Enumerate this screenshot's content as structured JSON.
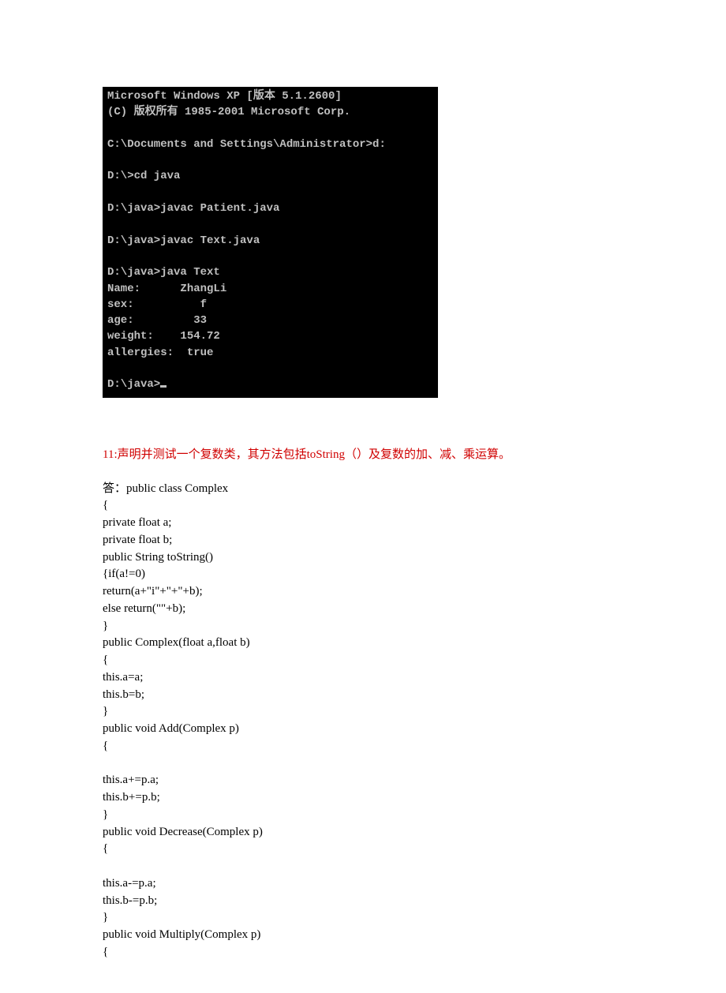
{
  "terminal": {
    "lines": [
      "Microsoft Windows XP [版本 5.1.2600]",
      "(C) 版权所有 1985-2001 Microsoft Corp.",
      "",
      "C:\\Documents and Settings\\Administrator>d:",
      "",
      "D:\\>cd java",
      "",
      "D:\\java>javac Patient.java",
      "",
      "D:\\java>javac Text.java",
      "",
      "D:\\java>java Text",
      "Name:      ZhangLi",
      "sex:          f",
      "age:         33",
      "weight:    154.72",
      "allergies:  true",
      "",
      "D:\\java>"
    ]
  },
  "question": {
    "number": "11:",
    "text": "声明并测试一个复数类，其方法包括toString（）及复数的加、减、乘运算。"
  },
  "answer": {
    "prefix": "答：",
    "code": "public class Complex\n{\nprivate float a;\nprivate float b;\npublic String toString()\n{if(a!=0)\nreturn(a+\"i\"+\"+\"+b);\nelse return(\"\"+b);\n}\npublic Complex(float a,float b)\n{\nthis.a=a;\nthis.b=b;\n}\npublic void Add(Complex p)\n{\n\nthis.a+=p.a;\nthis.b+=p.b;\n}\npublic void Decrease(Complex p)\n{\n\nthis.a-=p.a;\nthis.b-=p.b;\n}\npublic void Multiply(Complex p)\n{"
  }
}
